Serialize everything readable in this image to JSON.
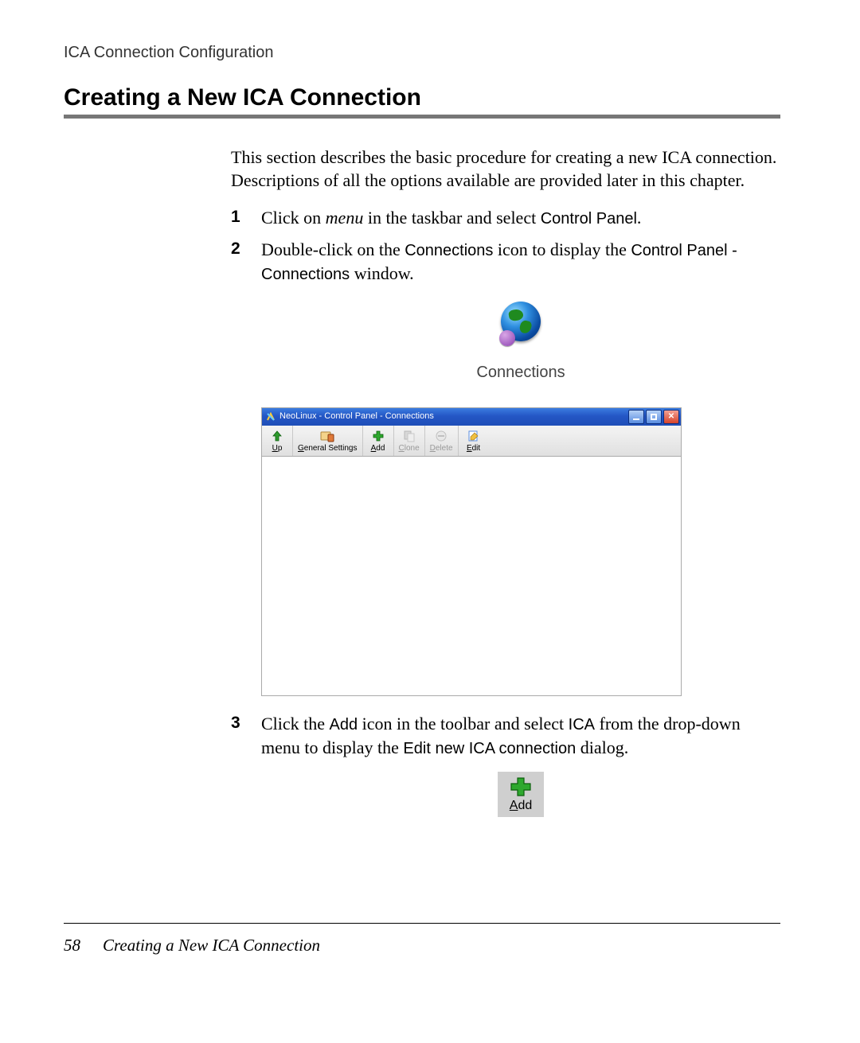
{
  "breadcrumb": "ICA Connection Configuration",
  "title": "Creating a New ICA Connection",
  "intro": "This section describes the basic procedure for creating a new ICA connection. Descriptions of all the options available are provided later in this chapter.",
  "steps": {
    "s1": {
      "a": "Click on ",
      "menu": "menu",
      "b": " in the taskbar and select ",
      "cp": "Control Panel",
      "c": "."
    },
    "s2": {
      "a": "Double-click on the ",
      "conn": "Connections",
      "b": " icon to display the ",
      "cpc": "Control Panel - Connections",
      "c": " window."
    },
    "s3": {
      "a": "Click the ",
      "add": "Add",
      "b": " icon in the toolbar and select ",
      "ica": "ICA",
      "c": " from the drop-down menu to display the ",
      "dlg": "Edit new ICA connection",
      "d": " dialog."
    }
  },
  "connections_icon_label": "Connections",
  "window": {
    "title": "NeoLinux - Control Panel - Connections",
    "toolbar": {
      "up": "Up",
      "general": "General Settings",
      "add": "Add",
      "clone": "Clone",
      "delete": "Delete",
      "edit": "Edit"
    }
  },
  "add_button_label": "Add",
  "footer": {
    "page": "58",
    "title": "Creating a New ICA Connection"
  }
}
